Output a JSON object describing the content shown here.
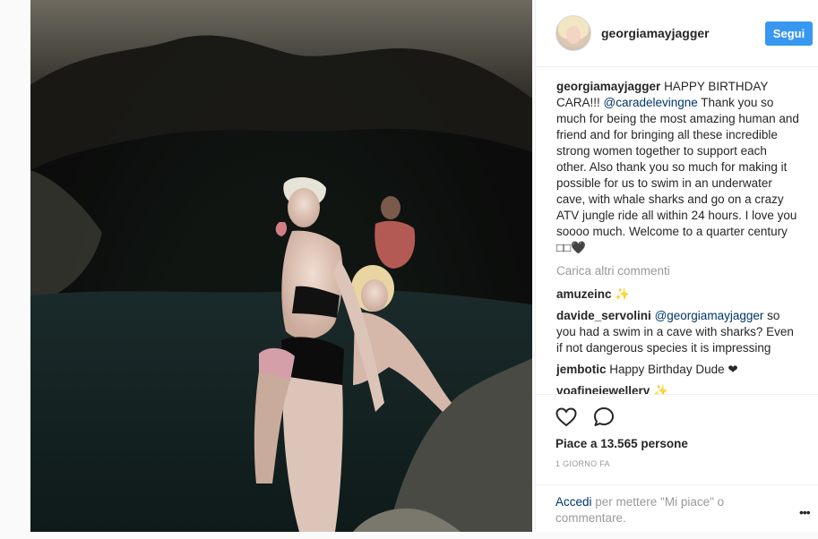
{
  "post": {
    "username": "georgiamayjagger",
    "follow_label": "Segui",
    "caption_user": "georgiamayjagger",
    "caption_text_1": "HAPPY BIRTHDAY CARA!!! ",
    "caption_mention": "@caradelevingne",
    "caption_text_2": " Thank you so much for being the most amazing human and friend and for bringing all these incredible strong women together to support each other. Also thank you so much for making it possible for us to swim in an underwater cave, with whale sharks and go on a crazy ATV jungle ride all within 24 hours. I love you soooo much. Welcome to a quarter century □□🖤",
    "load_more_label": "Carica altri commenti",
    "comments": [
      {
        "user": "amuzeinc",
        "text": " ✨"
      },
      {
        "user": "davide_servolini",
        "mention": "@georgiamayjagger",
        "text": " so you had a swim in a cave with sharks? Even if not dangerous species it is impressing"
      },
      {
        "user": "jembotic",
        "text": " Happy Birthday Dude ❤"
      },
      {
        "user": "voafinejewellery",
        "text": " ✨"
      }
    ],
    "likes_text": "Piace a 13.565 persone",
    "time_ago": "1 GIORNO FA",
    "login_link": "Accedi",
    "login_text": " per mettere \"Mi piace\" o commentare.",
    "more_label": "•••"
  },
  "colors": {
    "follow_button": "#3897f0",
    "link": "#003569",
    "muted": "#999999",
    "text": "#262626"
  },
  "icons": {
    "like": "heart-icon",
    "comment": "speech-bubble-icon",
    "more": "more-options-icon"
  }
}
